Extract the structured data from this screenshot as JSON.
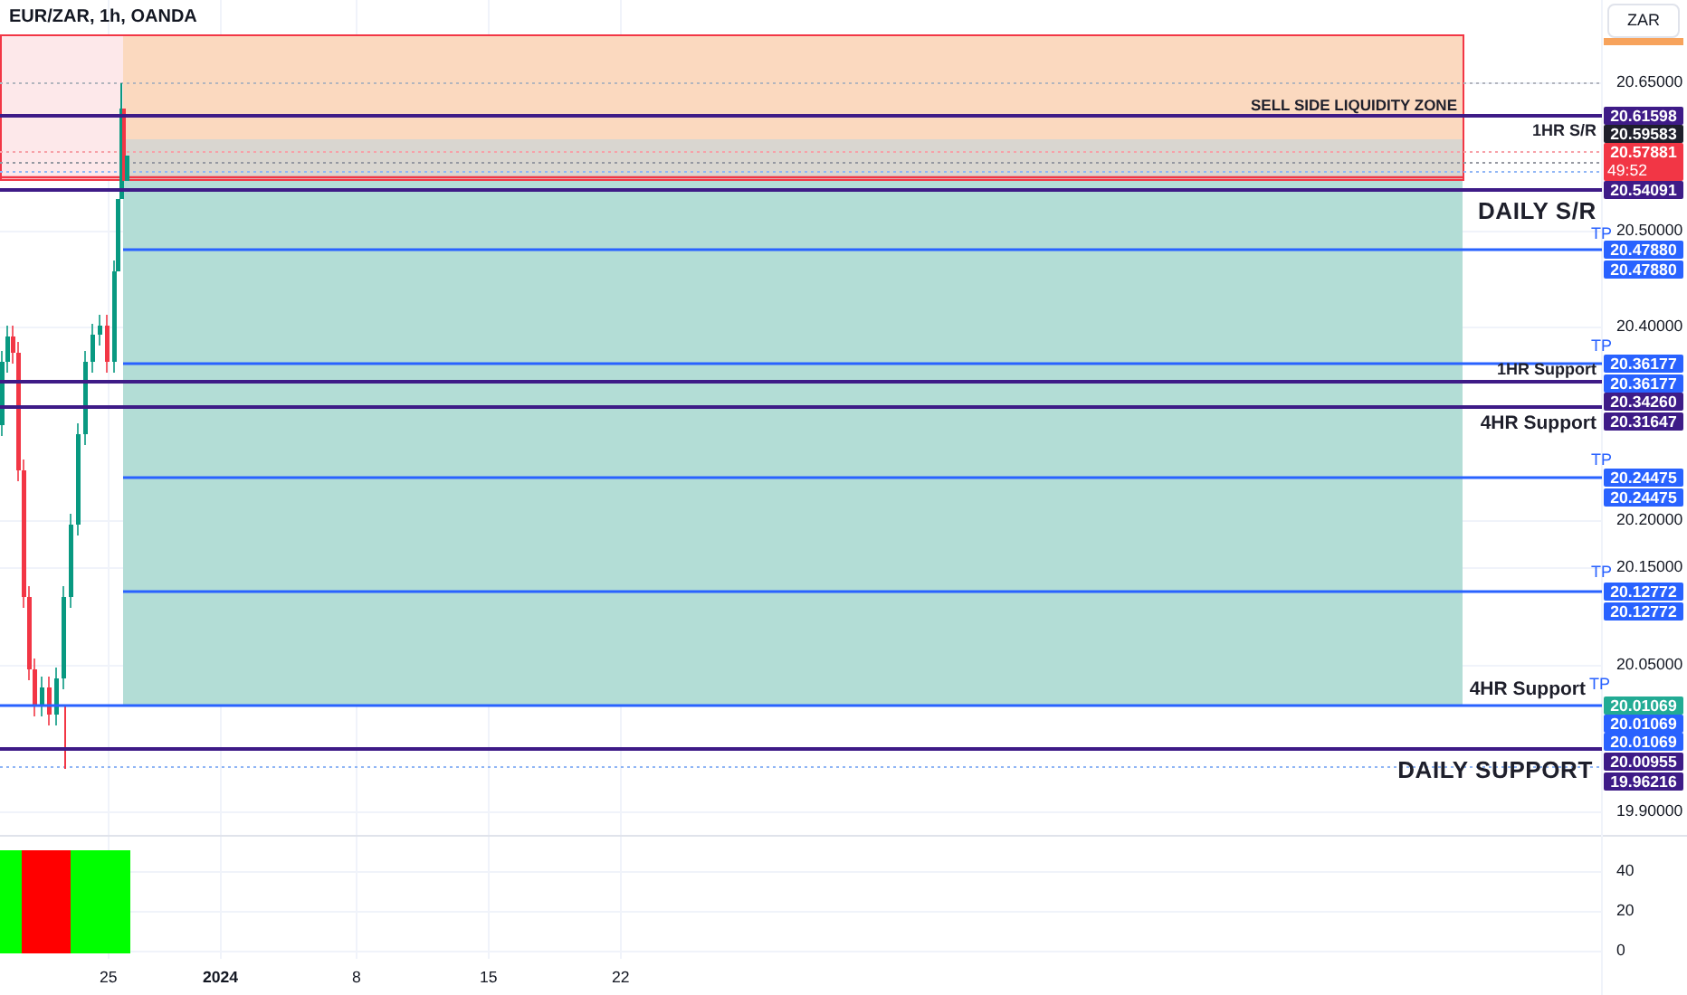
{
  "header": {
    "title": "EUR/ZAR, 1h, OANDA"
  },
  "currency_button": {
    "label": "ZAR"
  },
  "price_axis": {
    "ticks": [
      "20.65000",
      "20.50000",
      "20.40000",
      "20.20000",
      "20.15000",
      "20.05000",
      "19.90000"
    ]
  },
  "price_labels": [
    {
      "text": "20.61598",
      "color": "#3e1b87"
    },
    {
      "text": "20.59583",
      "color": "#1e1f2b"
    },
    {
      "text": "20.57881",
      "color": "#f23645",
      "countdown": "49:52"
    },
    {
      "text": "20.54091",
      "color": "#3e1b87"
    },
    {
      "text": "20.47880",
      "color": "#2962ff"
    },
    {
      "text": "20.47880",
      "color": "#2962ff"
    },
    {
      "text": "20.36177",
      "color": "#2962ff"
    },
    {
      "text": "20.36177",
      "color": "#2962ff"
    },
    {
      "text": "20.34260",
      "color": "#3e1b87"
    },
    {
      "text": "20.31647",
      "color": "#3e1b87"
    },
    {
      "text": "20.24475",
      "color": "#2962ff"
    },
    {
      "text": "20.24475",
      "color": "#2962ff"
    },
    {
      "text": "20.12772",
      "color": "#2962ff"
    },
    {
      "text": "20.12772",
      "color": "#2962ff"
    },
    {
      "text": "20.01069",
      "color": "#22ab94"
    },
    {
      "text": "20.01069",
      "color": "#2962ff"
    },
    {
      "text": "20.01069",
      "color": "#2962ff"
    },
    {
      "text": "20.00955",
      "color": "#3e1b87"
    },
    {
      "text": "19.96216",
      "color": "#3e1b87"
    }
  ],
  "annotations": [
    {
      "text": "SELL SIDE LIQUIDITY ZONE",
      "kind": "zone"
    },
    {
      "text": "1HR S/R",
      "kind": "small"
    },
    {
      "text": "DAILY S/R",
      "kind": "large"
    },
    {
      "text": "TP",
      "kind": "tp"
    },
    {
      "text": "TP",
      "kind": "tp"
    },
    {
      "text": "1HR Support",
      "kind": "small"
    },
    {
      "text": "4HR Support",
      "kind": "medium"
    },
    {
      "text": "TP",
      "kind": "tp"
    },
    {
      "text": "TP",
      "kind": "tp"
    },
    {
      "text": "4HR Support",
      "kind": "medium"
    },
    {
      "text": "TP",
      "kind": "tp"
    },
    {
      "text": "DAILY SUPPORT",
      "kind": "large"
    }
  ],
  "indicator_axis": {
    "ticks": [
      "40",
      "20",
      "0"
    ]
  },
  "time_axis": {
    "ticks": [
      {
        "label": "25",
        "kind": "day"
      },
      {
        "label": "2024",
        "kind": "year"
      },
      {
        "label": "8",
        "kind": "day"
      },
      {
        "label": "15",
        "kind": "day"
      },
      {
        "label": "22",
        "kind": "day"
      }
    ]
  }
}
